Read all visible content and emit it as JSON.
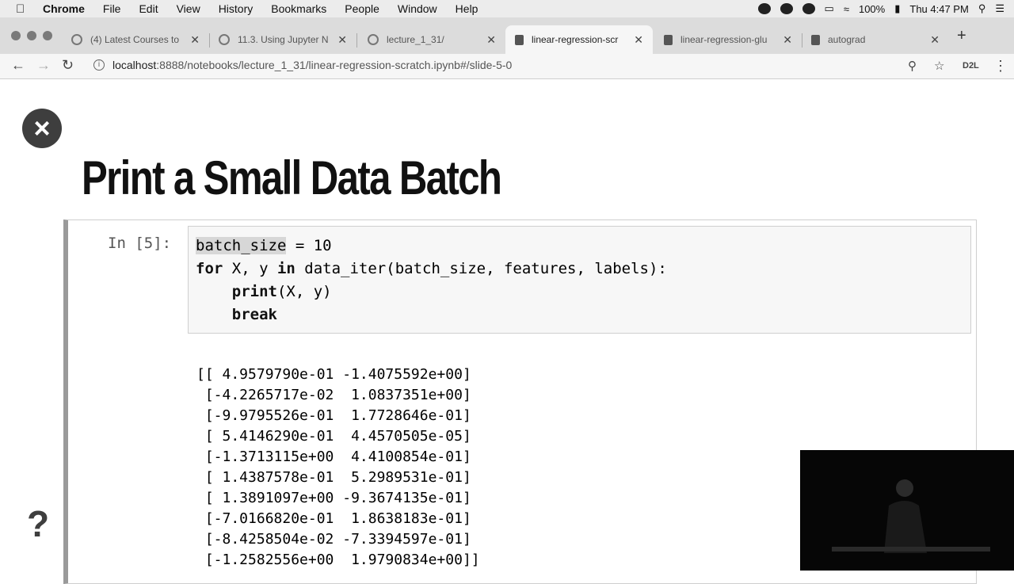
{
  "menubar": {
    "items": [
      "Chrome",
      "File",
      "Edit",
      "View",
      "History",
      "Bookmarks",
      "People",
      "Window",
      "Help"
    ],
    "battery": "100%",
    "clock": "Thu 4:47 PM"
  },
  "tabs": [
    {
      "label": "(4) Latest Courses to"
    },
    {
      "label": "11.3. Using Jupyter N"
    },
    {
      "label": "lecture_1_31/"
    },
    {
      "label": "linear-regression-scr"
    },
    {
      "label": "linear-regression-glu"
    },
    {
      "label": "autograd"
    }
  ],
  "toolbar": {
    "url_host": "localhost",
    "url_path": ":8888/notebooks/lecture_1_31/linear-regression-scratch.ipynb#/slide-5-0",
    "extension_label": "D2L"
  },
  "slide": {
    "title": "Print a Small Data Batch",
    "prompt": "In [5]:",
    "code": {
      "line1_var": "batch_size",
      "line1_rest": " = 10",
      "line2_kw1": "for",
      "line2_mid": " X, y ",
      "line2_kw2": "in",
      "line2_rest": " data_iter(batch_size, features, labels):",
      "line3_indent": "    ",
      "line3_kw": "print",
      "line3_rest": "(X, y)",
      "line4_indent": "    ",
      "line4_kw": "break"
    },
    "output_lines": [
      "[[ 4.9579790e-01 -1.4075592e+00]",
      " [-4.2265717e-02  1.0837351e+00]",
      " [-9.9795526e-01  1.7728646e-01]",
      " [ 5.4146290e-01  4.4570505e-05]",
      " [-1.3713115e+00  4.4100854e-01]",
      " [ 1.4387578e-01  5.2989531e-01]",
      " [ 1.3891097e+00 -9.3674135e-01]",
      " [-7.0166820e-01  1.8638183e-01]",
      " [-8.4258504e-02 -7.3394597e-01]",
      " [-1.2582556e+00  1.9790834e+00]]"
    ]
  }
}
